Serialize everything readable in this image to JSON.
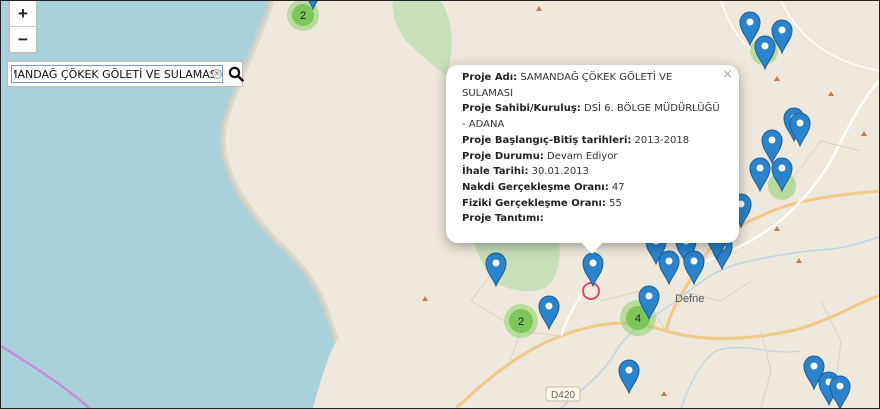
{
  "map": {
    "zoom_in_label": "+",
    "zoom_out_label": "−",
    "road_label": "D420",
    "town_label": "Defne",
    "colors": {
      "sea": "#a9d1dc",
      "land": "#ede9df",
      "park": "#c9dfb8",
      "road": "#f3c98a",
      "river": "#bcd5e6",
      "boundary": "#c190d6",
      "marker": "#2b83cb",
      "cluster": "#8ccf6a"
    }
  },
  "search": {
    "value": "SAMANDAĞ ÇÖKEK GÖLETİ VE SULAMASI"
  },
  "popup": {
    "close_label": "×",
    "rows": [
      {
        "label": "Proje Adı:",
        "value": " SAMANDAĞ ÇÖKEK GÖLETİ VE SULAMASI"
      },
      {
        "label": "Proje Sahibi/Kuruluş:",
        "value": " DSİ 6. BÖLGE MÜDÜRLÜĞÜ - ADANA"
      },
      {
        "label": "Proje Başlangıç-Bitiş tarihleri:",
        "value": " 2013-2018"
      },
      {
        "label": "Proje Durumu:",
        "value": " Devam Ediyor"
      },
      {
        "label": "İhale Tarihi:",
        "value": " 30.01.2013"
      },
      {
        "label": "Nakdi Gerçekleşme Oranı:",
        "value": " 47"
      },
      {
        "label": "Fiziki Gerçekleşme Oranı:",
        "value": " 55"
      },
      {
        "label": "Proje Tanıtımı:",
        "value": ""
      }
    ]
  },
  "clusters": [
    {
      "count": "2"
    },
    {
      "count": "2"
    },
    {
      "count": "4"
    }
  ]
}
